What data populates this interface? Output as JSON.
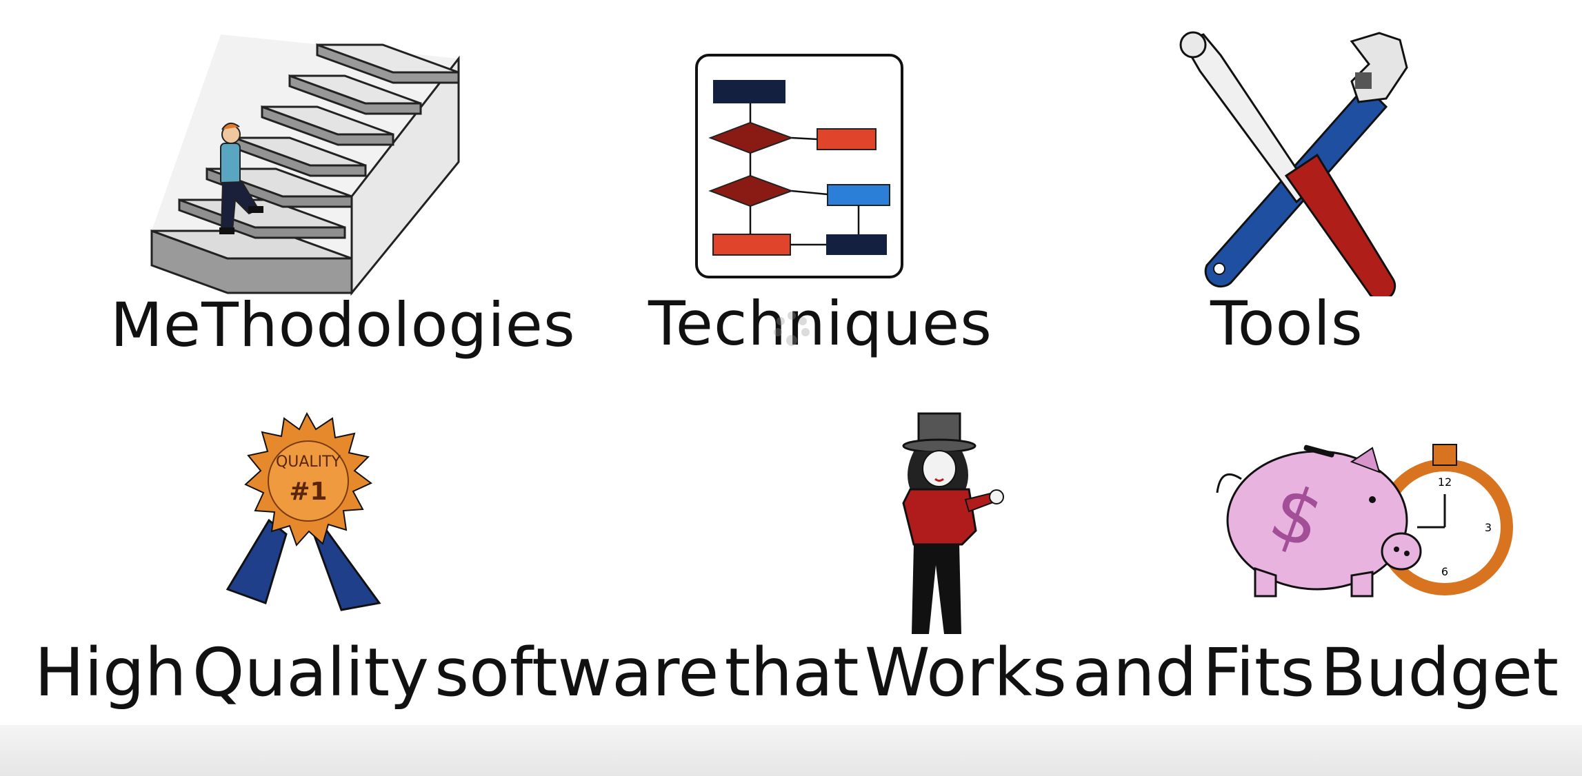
{
  "labels": {
    "methodologies": "MeThodologies",
    "techniques": "Techniques",
    "tools": "Tools"
  },
  "caption": [
    "High",
    "Quality",
    "software",
    "that",
    "Works",
    "and",
    "Fits",
    "Budget"
  ],
  "badge": {
    "text": "QUALITY",
    "number": "#1"
  },
  "clock": {
    "twelve": "12",
    "three": "3",
    "six": "6"
  },
  "colors": {
    "navy": "#13203f",
    "red": "#e0452b",
    "darkred": "#8a1b14",
    "blue": "#2b7fd6",
    "orange": "#e6892d",
    "pink": "#e8b4df"
  }
}
